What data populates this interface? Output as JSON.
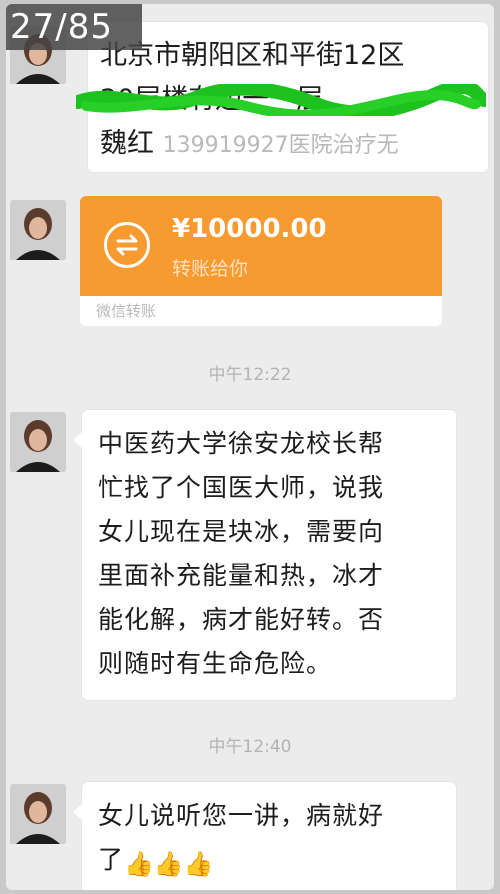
{
  "image_counter": "27/85",
  "messages": {
    "address": {
      "line1": "北京市朝阳区和平街12区",
      "line2": "20层楼有边一一层",
      "line3_name": "魏红",
      "line3_faint": "139919927医院治疗无"
    },
    "transfer": {
      "amount": "¥10000.00",
      "subtitle": "转账给你",
      "footer": "微信转账"
    },
    "time1": "中午12:22",
    "long_text": "中医药大学徐安龙校长帮\n忙找了个国医大师，说我\n女儿现在是块冰，需要向\n里面补充能量和热，冰才\n能化解，病才能好转。否\n则随时有生命危险。",
    "time2": "中午12:40",
    "last_text": "女儿说听您一讲，病就好\n了",
    "last_emoji": "👍👍👍"
  },
  "colors": {
    "transfer_orange": "#f79a2f",
    "background": "#ececec",
    "scribble_green": "#1ec21e"
  },
  "icons": [
    "transfer-exchange-icon",
    "avatar-icon",
    "thumbs-up-icon"
  ]
}
